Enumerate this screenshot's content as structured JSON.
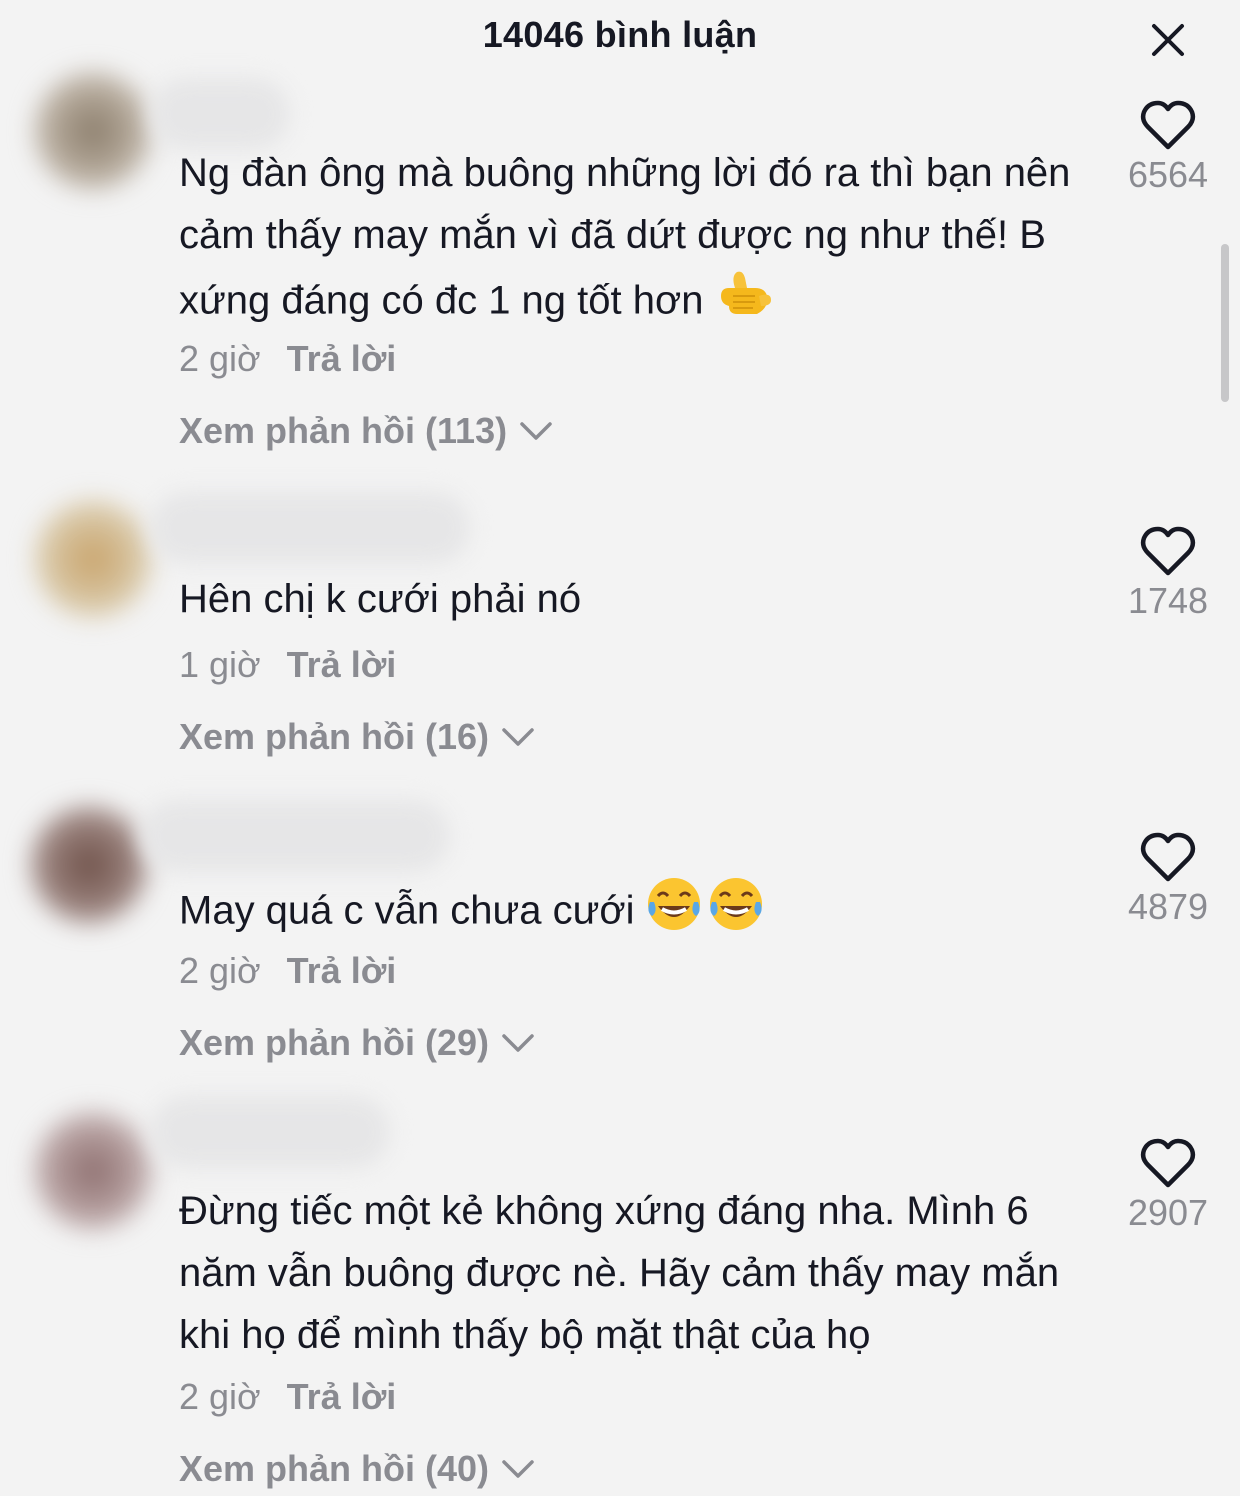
{
  "header": {
    "title": "14046 bình luận",
    "close_icon": "close-icon"
  },
  "comments": [
    {
      "text": "Ng đàn ông mà buông những lời đó ra thì bạn nên cảm thấy may mắn vì đã dứt được ng như thế! B xứng đáng có đc 1 ng tốt hơn",
      "emoji": "call-me-hand-emoji",
      "time": "2 giờ",
      "reply_label": "Trả lời",
      "view_replies": "Xem phản hồi (113)",
      "likes": "6564"
    },
    {
      "text": "Hên chị k cưới phải nó",
      "time": "1 giờ",
      "reply_label": "Trả lời",
      "view_replies": "Xem phản hồi (16)",
      "likes": "1748"
    },
    {
      "text": "May quá c vẫn chưa cưới",
      "emoji": "tears-of-joy-emoji",
      "time": "2 giờ",
      "reply_label": "Trả lời",
      "view_replies": "Xem phản hồi (29)",
      "likes": "4879"
    },
    {
      "text": "Đừng tiếc một kẻ không xứng đáng nha. Mình 6 năm vẫn buông được nè. Hãy cảm thấy may mắn khi họ để mình thấy bộ mặt thật của họ",
      "time": "2 giờ",
      "reply_label": "Trả lời",
      "view_replies": "Xem phản hồi (40)",
      "likes": "2907"
    }
  ],
  "colors": {
    "background": "#f3f3f3",
    "text_primary": "#161823",
    "text_secondary": "#8a8b91",
    "icon": "#161823"
  }
}
